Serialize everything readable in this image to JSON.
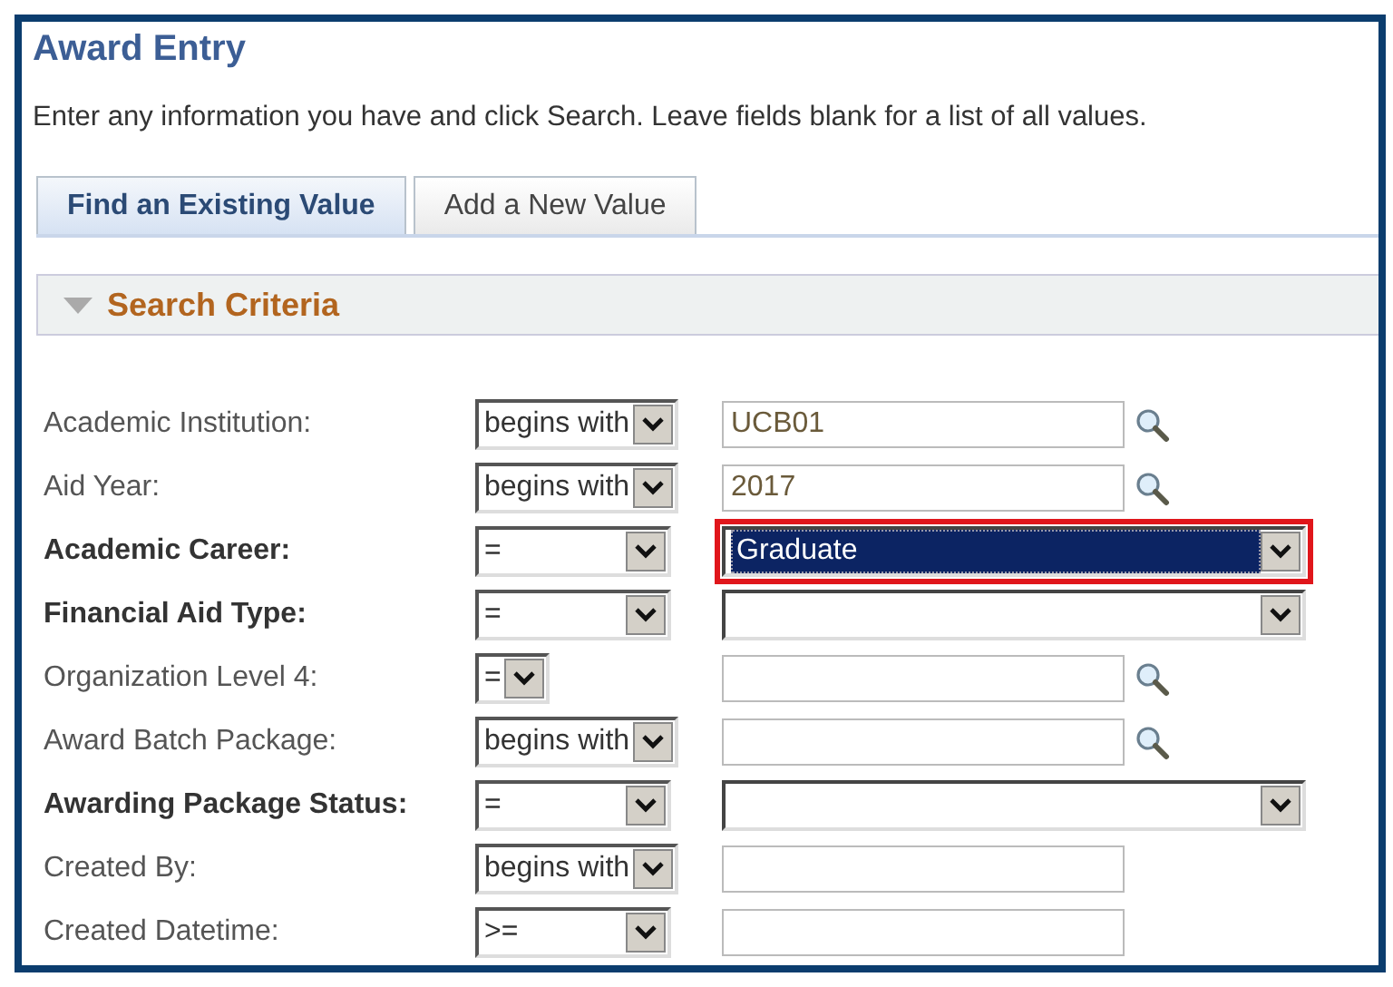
{
  "page": {
    "title": "Award Entry",
    "instructions": "Enter any information you have and click Search. Leave fields blank for a list of all values."
  },
  "tabs": [
    {
      "label": "Find an Existing Value",
      "selected": true
    },
    {
      "label": "Add a New Value",
      "selected": false
    }
  ],
  "section": {
    "title": "Search Criteria",
    "expanded": true
  },
  "rows": [
    {
      "label": "Academic Institution:",
      "bold": false,
      "operator": "begins with",
      "kind": "lookup",
      "value": "UCB01"
    },
    {
      "label": "Aid Year:",
      "bold": false,
      "operator": "begins with",
      "kind": "lookup",
      "value": "2017"
    },
    {
      "label": "Academic Career:",
      "bold": true,
      "operator": "=",
      "kind": "dropdown",
      "value": "Graduate",
      "focused": true
    },
    {
      "label": "Financial Aid Type:",
      "bold": true,
      "operator": "=",
      "kind": "dropdown",
      "focused": false
    },
    {
      "label": "Organization Level 4:",
      "bold": false,
      "operator": "=",
      "kind": "lookup"
    },
    {
      "label": "Award Batch Package:",
      "bold": false,
      "operator": "begins with",
      "kind": "lookup"
    },
    {
      "label": "Awarding Package Status:",
      "bold": true,
      "operator": "=",
      "kind": "dropdown",
      "focused": false
    },
    {
      "label": "Created By:",
      "bold": false,
      "operator": "begins with",
      "kind": "text"
    },
    {
      "label": "Created Datetime:",
      "bold": false,
      "operator": ">=",
      "kind": "text"
    }
  ]
}
